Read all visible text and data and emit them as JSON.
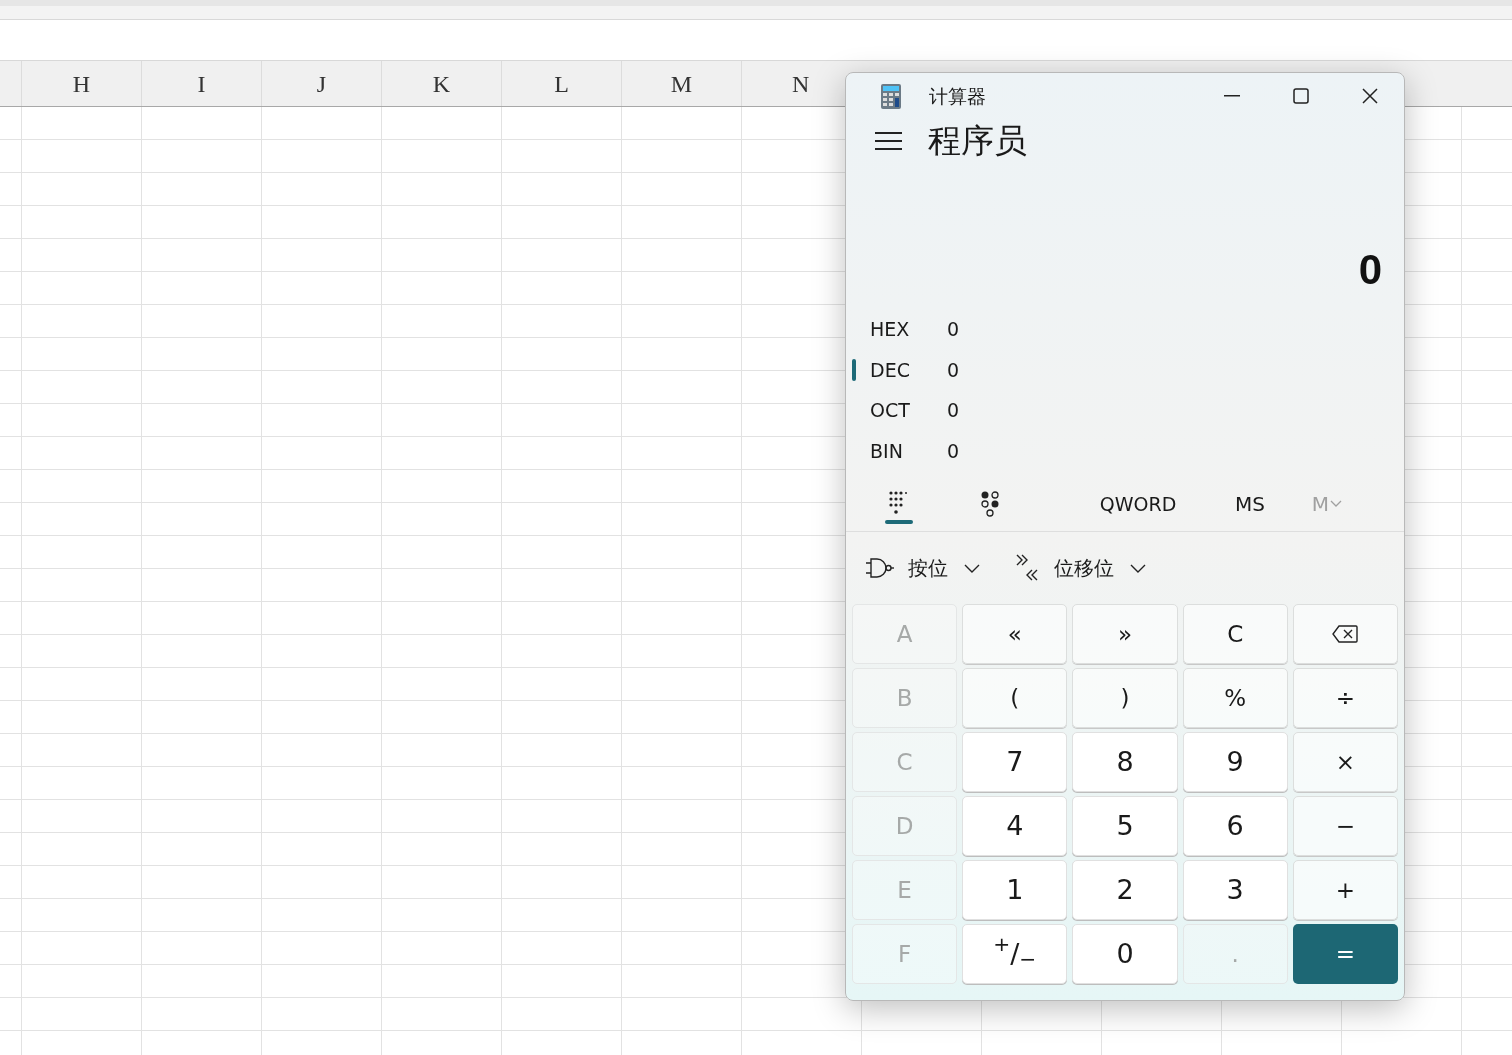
{
  "spreadsheet": {
    "columns": [
      "H",
      "I",
      "J",
      "K",
      "L",
      "M",
      "N"
    ]
  },
  "calculator": {
    "title": "计算器",
    "mode": "程序员",
    "display": "0",
    "radix": [
      {
        "label": "HEX",
        "value": "0",
        "selected": false
      },
      {
        "label": "DEC",
        "value": "0",
        "selected": true
      },
      {
        "label": "OCT",
        "value": "0",
        "selected": false
      },
      {
        "label": "BIN",
        "value": "0",
        "selected": false
      }
    ],
    "tabs": [
      {
        "kind": "keypad",
        "selected": true
      },
      {
        "kind": "bits",
        "selected": false
      }
    ],
    "word_size": "QWORD",
    "memory": [
      {
        "label": "MS",
        "disabled": false
      },
      {
        "label": "M",
        "disabled": true
      }
    ],
    "toolbar": [
      {
        "kind": "bitwise",
        "label": "按位"
      },
      {
        "kind": "shift",
        "label": "位移位"
      }
    ],
    "keys": [
      {
        "kind": "hex",
        "label": "A",
        "disabled": true
      },
      {
        "kind": "op",
        "label": "«",
        "disabled": false
      },
      {
        "kind": "op",
        "label": "»",
        "disabled": false
      },
      {
        "kind": "op",
        "label": "C",
        "disabled": false
      },
      {
        "kind": "backspace",
        "disabled": false
      },
      {
        "kind": "hex",
        "label": "B",
        "disabled": true
      },
      {
        "kind": "op",
        "label": "(",
        "disabled": false
      },
      {
        "kind": "op",
        "label": ")",
        "disabled": false
      },
      {
        "kind": "op",
        "label": "%",
        "disabled": false
      },
      {
        "kind": "op",
        "label": "÷",
        "disabled": false
      },
      {
        "kind": "hex",
        "label": "C",
        "disabled": true
      },
      {
        "kind": "digit",
        "label": "7",
        "disabled": false
      },
      {
        "kind": "digit",
        "label": "8",
        "disabled": false
      },
      {
        "kind": "digit",
        "label": "9",
        "disabled": false
      },
      {
        "kind": "op",
        "label": "×",
        "disabled": false
      },
      {
        "kind": "hex",
        "label": "D",
        "disabled": true
      },
      {
        "kind": "digit",
        "label": "4",
        "disabled": false
      },
      {
        "kind": "digit",
        "label": "5",
        "disabled": false
      },
      {
        "kind": "digit",
        "label": "6",
        "disabled": false
      },
      {
        "kind": "op",
        "label": "−",
        "disabled": false
      },
      {
        "kind": "hex",
        "label": "E",
        "disabled": true
      },
      {
        "kind": "digit",
        "label": "1",
        "disabled": false
      },
      {
        "kind": "digit",
        "label": "2",
        "disabled": false
      },
      {
        "kind": "digit",
        "label": "3",
        "disabled": false
      },
      {
        "kind": "op",
        "label": "+",
        "disabled": false
      },
      {
        "kind": "hex",
        "label": "F",
        "disabled": true
      },
      {
        "kind": "digit",
        "label": "$^{+}$/$_{−}$",
        "disabled": false
      },
      {
        "kind": "digit",
        "label": "0",
        "disabled": false
      },
      {
        "kind": "op",
        "label": ".",
        "disabled": true
      },
      {
        "kind": "equals",
        "label": "=",
        "disabled": false
      }
    ]
  }
}
